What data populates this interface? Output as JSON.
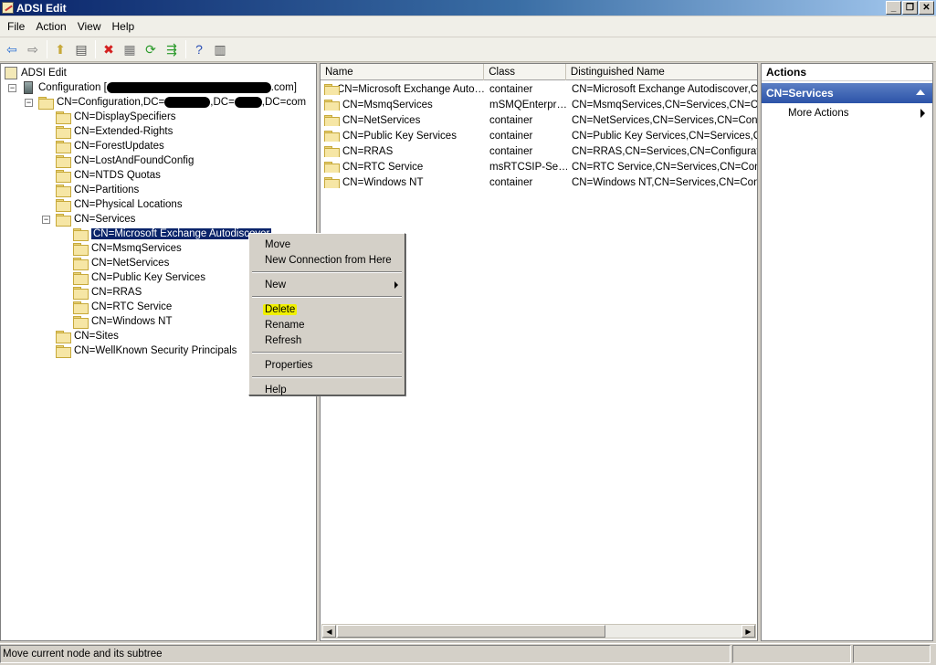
{
  "window": {
    "title": "ADSI Edit",
    "buttons": [
      "_",
      "❐",
      "✕"
    ]
  },
  "menubar": [
    "File",
    "Action",
    "View",
    "Help"
  ],
  "toolbar": [
    {
      "icon": "back-arrow-icon",
      "glyph": "⇦",
      "color": "#2a6fd4"
    },
    {
      "icon": "forward-arrow-icon",
      "glyph": "⇨",
      "color": "#7c7c7c"
    },
    {
      "icon": "up-folder-icon",
      "glyph": "⬆",
      "color": "#c7a93a"
    },
    {
      "icon": "show-hide-tree-icon",
      "glyph": "▤",
      "color": "#555555"
    },
    {
      "icon": "delete-icon",
      "glyph": "✖",
      "color": "#d42020"
    },
    {
      "icon": "properties-icon",
      "glyph": "▦",
      "color": "#777777"
    },
    {
      "icon": "refresh-icon",
      "glyph": "⟳",
      "color": "#2a9a2a"
    },
    {
      "icon": "export-list-icon",
      "glyph": "⇶",
      "color": "#2a9a2a"
    },
    {
      "icon": "help-icon",
      "glyph": "?",
      "color": "#2a4fb4"
    },
    {
      "icon": "show-hide-action-pane-icon",
      "glyph": "▥",
      "color": "#555555"
    }
  ],
  "tree": {
    "root": "ADSI Edit",
    "configuration_label": "Configuration [",
    "configuration_suffix": ".com]",
    "naming_context_prefix": "CN=Configuration,DC=",
    "naming_context_mid": ",DC=",
    "naming_context_suffix": ",DC=com",
    "containers": [
      "CN=DisplaySpecifiers",
      "CN=Extended-Rights",
      "CN=ForestUpdates",
      "CN=LostAndFoundConfig",
      "CN=NTDS Quotas",
      "CN=Partitions",
      "CN=Physical Locations",
      "CN=Services"
    ],
    "services_children": [
      "CN=Microsoft Exchange Autodiscover",
      "CN=MsmqServices",
      "CN=NetServices",
      "CN=Public Key Services",
      "CN=RRAS",
      "CN=RTC Service",
      "CN=Windows NT"
    ],
    "after_services": [
      "CN=Sites",
      "CN=WellKnown Security Principals"
    ]
  },
  "list": {
    "columns": [
      "Name",
      "Class",
      "Distinguished Name"
    ],
    "rows": [
      [
        "CN=Microsoft Exchange Auto…",
        "container",
        "CN=Microsoft Exchange Autodiscover,CN"
      ],
      [
        "CN=MsmqServices",
        "mSMQEnterpr…",
        "CN=MsmqServices,CN=Services,CN=Con"
      ],
      [
        "CN=NetServices",
        "container",
        "CN=NetServices,CN=Services,CN=Config"
      ],
      [
        "CN=Public Key Services",
        "container",
        "CN=Public Key Services,CN=Services,CN="
      ],
      [
        "CN=RRAS",
        "container",
        "CN=RRAS,CN=Services,CN=Configuratio"
      ],
      [
        "CN=RTC Service",
        "msRTCSIP-Se…",
        "CN=RTC Service,CN=Services,CN=Config"
      ],
      [
        "CN=Windows NT",
        "container",
        "CN=Windows NT,CN=Services,CN=Config"
      ]
    ]
  },
  "actions": {
    "title": "Actions",
    "section": "CN=Services",
    "items": [
      "More Actions"
    ]
  },
  "context_menu": {
    "group1": [
      "Move",
      "New Connection from Here"
    ],
    "group2": [
      "New"
    ],
    "group3": [
      "Delete",
      "Rename",
      "Refresh"
    ],
    "group4": [
      "Properties"
    ],
    "group5": [
      "Help"
    ],
    "highlight_color": "#f0f000"
  },
  "status": {
    "text": "Move current node and its subtree"
  }
}
